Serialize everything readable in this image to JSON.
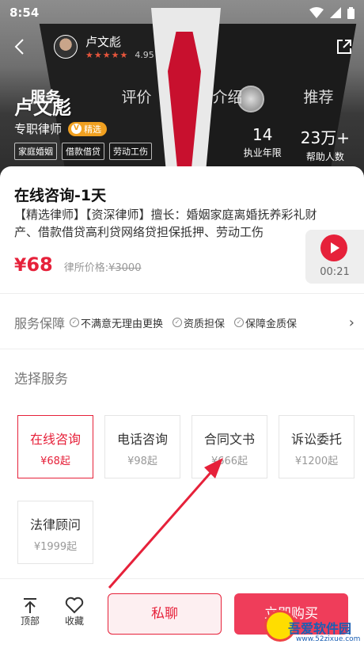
{
  "status_bar": {
    "time": "8:54"
  },
  "header": {
    "lawyer_name": "卢文彪",
    "stars": "★★★★★",
    "rating": "4.95"
  },
  "tabs": [
    {
      "label": "服务"
    },
    {
      "label": "评价"
    },
    {
      "label": "介绍"
    },
    {
      "label": "推荐"
    }
  ],
  "profile": {
    "name": "卢文彪",
    "title": "专职律师",
    "badge": "精选",
    "badge_icon": "V",
    "tags": [
      "家庭婚姻",
      "借款借贷",
      "劳动工伤"
    ],
    "stats": [
      {
        "value": "14",
        "label": "执业年限"
      },
      {
        "value": "23万+",
        "label": "帮助人数"
      }
    ]
  },
  "service": {
    "title": "在线咨询-1天",
    "description": "【精选律师】【资深律师】擅长：婚姻家庭离婚抚养彩礼财产、借款借贷高利贷网络贷担保抵押、劳动工伤",
    "price_symbol": "¥",
    "price": "68",
    "original_price_label": "律所价格:",
    "original_price": "¥3000"
  },
  "video": {
    "duration": "00:21"
  },
  "guarantee": {
    "title": "服务保障",
    "items": [
      "不满意无理由更换",
      "资质担保",
      "保障金质保"
    ]
  },
  "choose": {
    "title": "选择服务",
    "options": [
      {
        "name": "在线咨询",
        "price": "¥68起",
        "selected": true
      },
      {
        "name": "电话咨询",
        "price": "¥98起",
        "selected": false
      },
      {
        "name": "合同文书",
        "price": "¥666起",
        "selected": false
      },
      {
        "name": "诉讼委托",
        "price": "¥1200起",
        "selected": false
      },
      {
        "name": "法律顾问",
        "price": "¥1999起",
        "selected": false
      }
    ]
  },
  "bottom_bar": {
    "top_label": "顶部",
    "fav_label": "收藏",
    "chat_label": "私聊",
    "buy_label": "立即购买"
  },
  "watermark": {
    "text": "吾爱软件园",
    "url": "www.52zixue.com"
  },
  "colors": {
    "accent": "#e6213a",
    "buy": "#ef3d5a",
    "badge": "#f0a020"
  }
}
